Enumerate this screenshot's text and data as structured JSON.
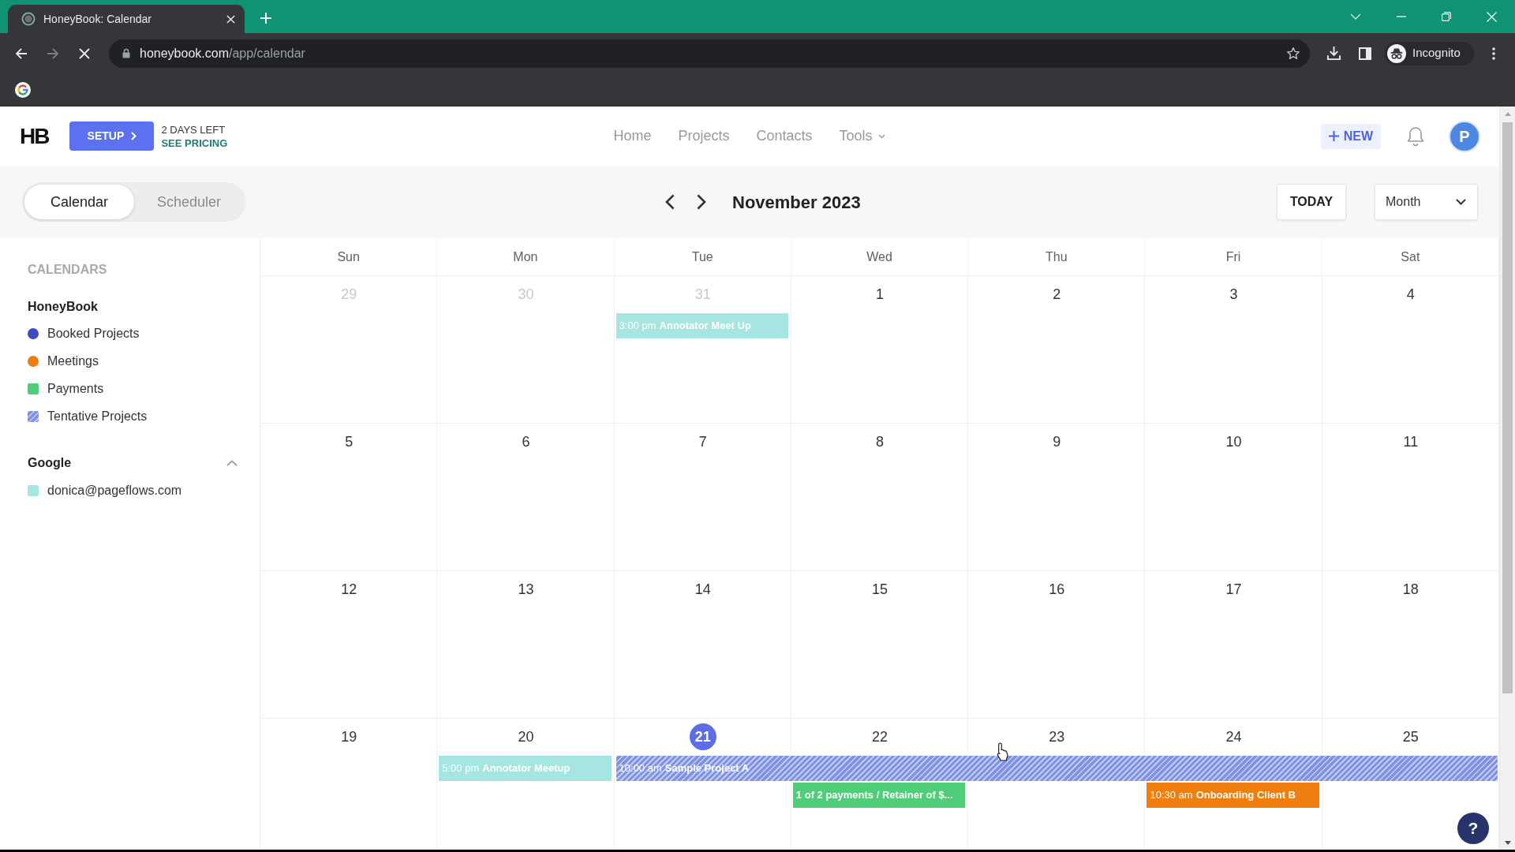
{
  "browser": {
    "tab_title": "HoneyBook: Calendar",
    "nav_buttons": [
      {
        "kind": "back",
        "disabled": false
      },
      {
        "kind": "forward",
        "disabled": true
      },
      {
        "kind": "stop",
        "disabled": false
      }
    ],
    "url": {
      "host": "honeybook.com",
      "path": "/app/calendar"
    },
    "profile": "Incognito"
  },
  "header": {
    "logo": "HB",
    "setup_button": "SETUP",
    "trial_notice": "2 DAYS LEFT",
    "pricing_link": "SEE PRICING",
    "nav": [
      {
        "label": "Home",
        "dropdown": false
      },
      {
        "label": "Projects",
        "dropdown": false
      },
      {
        "label": "Contacts",
        "dropdown": false
      },
      {
        "label": "Tools",
        "dropdown": true
      }
    ],
    "new_button": "NEW",
    "avatar": "P"
  },
  "toolbar": {
    "view_tabs": [
      {
        "label": "Calendar",
        "selected": true
      },
      {
        "label": "Scheduler",
        "selected": false
      }
    ],
    "period": "November 2023",
    "today_button": "TODAY",
    "view_select": "Month"
  },
  "sidebar": {
    "heading": "CALENDARS",
    "groups": [
      {
        "title": "HoneyBook",
        "kind": "plain",
        "items": [
          {
            "label": "Booked Projects",
            "kind": "circle",
            "hatched": false,
            "color": "#3b4cc0"
          },
          {
            "label": "Meetings",
            "kind": "circle",
            "hatched": false,
            "color": "#f07e0e"
          },
          {
            "label": "Payments",
            "kind": "square",
            "hatched": false,
            "color": "#4fcd79"
          },
          {
            "label": "Tentative Projects",
            "kind": "square",
            "hatched": true,
            "color": "#8d9ff1"
          }
        ]
      },
      {
        "title": "Google",
        "kind": "collapsible",
        "expanded": true,
        "items": [
          {
            "label": "donica@pageflows.com",
            "kind": "square",
            "hatched": false,
            "color": "#a5e5e2"
          }
        ]
      }
    ]
  },
  "calendar": {
    "weekdays": [
      "Sun",
      "Mon",
      "Tue",
      "Wed",
      "Thu",
      "Fri",
      "Sat"
    ],
    "weeks": [
      {
        "days": [
          {
            "date": "29",
            "muted": true,
            "today": false
          },
          {
            "date": "30",
            "muted": true,
            "today": false
          },
          {
            "date": "31",
            "muted": true,
            "today": false,
            "events": [
              {
                "time": "3:00 pm",
                "title": "Annotator Meet Up",
                "color": "#a5e5e2",
                "hatched": false,
                "multi_day": false
              }
            ]
          },
          {
            "date": "1",
            "muted": false,
            "today": false
          },
          {
            "date": "2",
            "muted": false,
            "today": false
          },
          {
            "date": "3",
            "muted": false,
            "today": false
          },
          {
            "date": "4",
            "muted": false,
            "today": false
          }
        ]
      },
      {
        "days": [
          {
            "date": "5",
            "muted": false,
            "today": false
          },
          {
            "date": "6",
            "muted": false,
            "today": false
          },
          {
            "date": "7",
            "muted": false,
            "today": false
          },
          {
            "date": "8",
            "muted": false,
            "today": false
          },
          {
            "date": "9",
            "muted": false,
            "today": false
          },
          {
            "date": "10",
            "muted": false,
            "today": false
          },
          {
            "date": "11",
            "muted": false,
            "today": false
          }
        ]
      },
      {
        "days": [
          {
            "date": "12",
            "muted": false,
            "today": false
          },
          {
            "date": "13",
            "muted": false,
            "today": false
          },
          {
            "date": "14",
            "muted": false,
            "today": false
          },
          {
            "date": "15",
            "muted": false,
            "today": false
          },
          {
            "date": "16",
            "muted": false,
            "today": false
          },
          {
            "date": "17",
            "muted": false,
            "today": false
          },
          {
            "date": "18",
            "muted": false,
            "today": false
          }
        ]
      },
      {
        "days": [
          {
            "date": "19",
            "muted": false,
            "today": false
          },
          {
            "date": "20",
            "muted": false,
            "today": false,
            "events": [
              {
                "time": "5:00 pm",
                "title": "Annotator Meetup",
                "color": "#a5e5e2",
                "hatched": false,
                "multi_day": false
              }
            ]
          },
          {
            "date": "21",
            "muted": false,
            "today": true,
            "events": [
              {
                "time": "10:00 am",
                "title": "Sample Project A",
                "color": "#8d9ff1",
                "hatched": true,
                "multi_day": true
              }
            ]
          },
          {
            "date": "22",
            "muted": false,
            "today": false,
            "events": [
              {
                "title": "1 of 2 payments / Retainer of $...",
                "color": "#4fcd79",
                "hatched": false,
                "multi_day": false
              }
            ]
          },
          {
            "date": "23",
            "muted": false,
            "today": false
          },
          {
            "date": "24",
            "muted": false,
            "today": false,
            "events": [
              {
                "time": "10:30 am",
                "title": "Onboarding Client B",
                "color": "#f07e0e",
                "hatched": false,
                "multi_day": false
              }
            ]
          },
          {
            "date": "25",
            "muted": false,
            "today": false
          }
        ]
      }
    ]
  },
  "help_button": "?"
}
